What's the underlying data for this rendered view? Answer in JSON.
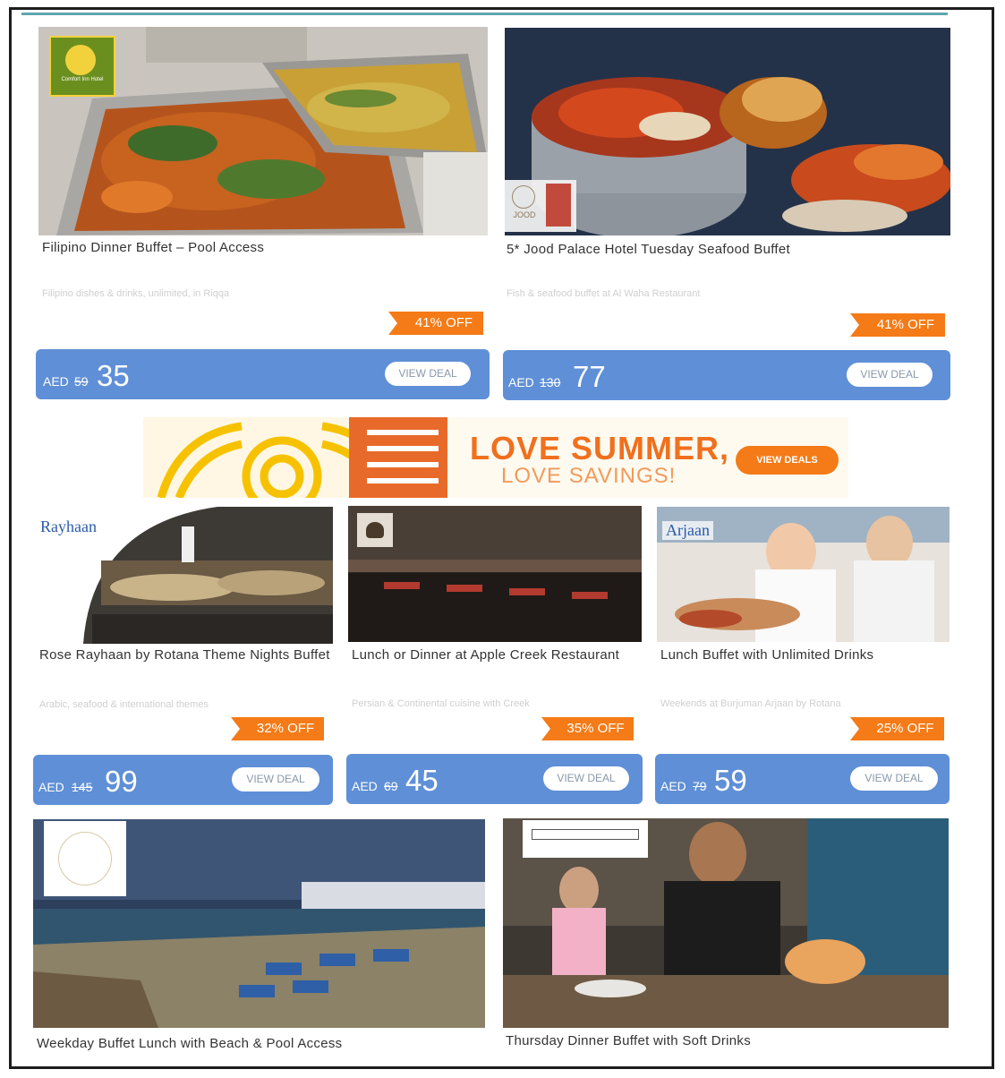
{
  "row1": [
    {
      "title": "Filipino Dinner Buffet – Pool Access",
      "subtitle": "Filipino dishes & drinks, unlimited, in Riqqa",
      "discount": "41% OFF",
      "currency": "AED",
      "old_price": "59",
      "new_price": "35",
      "view_label": "VIEW DEAL",
      "logo_text": "Comfort Inn Hotel"
    },
    {
      "title": "5* Jood Palace Hotel Tuesday Seafood Buffet",
      "subtitle": "Fish & seafood buffet at Al Waha Restaurant",
      "discount": "41% OFF",
      "currency": "AED",
      "old_price": "130",
      "new_price": "77",
      "view_label": "VIEW DEAL",
      "logo_text": "JOOD"
    }
  ],
  "banner": {
    "headline": "LOVE SUMMER,",
    "subline": "LOVE SAVINGS!",
    "button": "VIEW DEALS"
  },
  "row2": [
    {
      "title": "Rose Rayhaan by Rotana Theme Nights Buffet",
      "subtitle": "Arabic, seafood & international themes",
      "discount": "32% OFF",
      "currency": "AED",
      "old_price": "145",
      "new_price": "99",
      "view_label": "VIEW DEAL",
      "logo_text": "Rayhaan"
    },
    {
      "title": "Lunch or Dinner at Apple Creek Restaurant",
      "subtitle": "Persian & Continental cuisine with Creek",
      "discount": "35% OFF",
      "currency": "AED",
      "old_price": "69",
      "new_price": "45",
      "view_label": "VIEW DEAL",
      "logo_text": ""
    },
    {
      "title": "Lunch Buffet with Unlimited Drinks",
      "subtitle": "Weekends at Burjuman Arjaan by Rotana",
      "discount": "25% OFF",
      "currency": "AED",
      "old_price": "79",
      "new_price": "59",
      "view_label": "VIEW DEAL",
      "logo_text": "Arjaan"
    }
  ],
  "row3": [
    {
      "title": "Weekday Buffet Lunch with Beach & Pool Access"
    },
    {
      "title": "Thursday Dinner Buffet with Soft Drinks"
    }
  ]
}
